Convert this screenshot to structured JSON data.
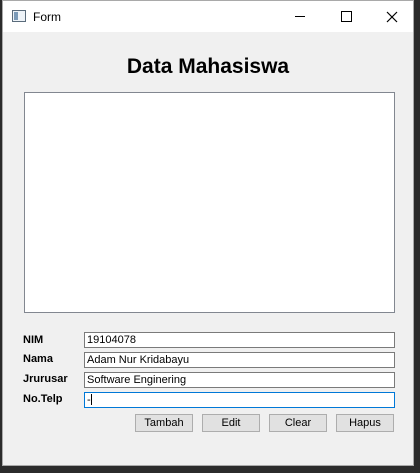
{
  "window": {
    "title": "Form"
  },
  "form": {
    "heading": "Data Mahasiswa",
    "fields": [
      {
        "label": "NIM",
        "value": "19104078"
      },
      {
        "label": "Nama",
        "value": "Adam Nur Kridabayu"
      },
      {
        "label": "Jrurusar",
        "value": "Software Enginering"
      },
      {
        "label": "No.Telp",
        "value": "-"
      }
    ],
    "buttons": {
      "tambah": "Tambah",
      "edit": "Edit",
      "clear": "Clear",
      "hapus": "Hapus"
    }
  }
}
